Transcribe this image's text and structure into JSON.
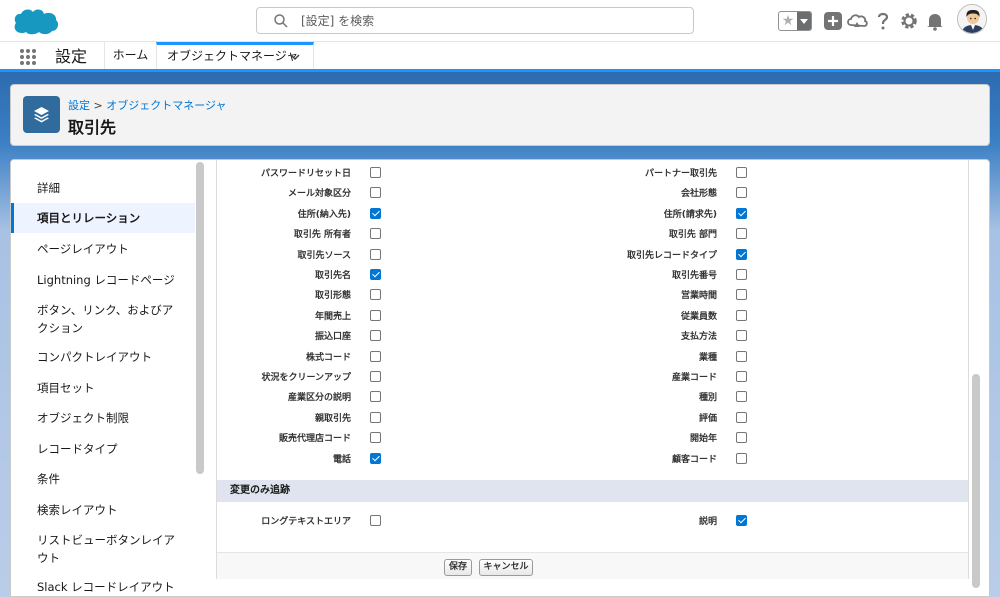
{
  "search": {
    "placeholder": "[設定] を検索"
  },
  "app_nav": {
    "app_name": "設定",
    "tabs": [
      {
        "label": "ホーム"
      },
      {
        "label": "オブジェクトマネージャ"
      }
    ]
  },
  "page_header": {
    "breadcrumb_root": "設定",
    "breadcrumb_separator": " > ",
    "breadcrumb_parent": "オブジェクトマネージャ",
    "title": "取引先"
  },
  "sidebar": {
    "items": [
      {
        "label": "詳細"
      },
      {
        "label": "項目とリレーション",
        "active": true
      },
      {
        "label": "ページレイアウト"
      },
      {
        "label": "Lightning レコードページ"
      },
      {
        "label": "ボタン、リンク、およびアクション"
      },
      {
        "label": "コンパクトレイアウト"
      },
      {
        "label": "項目セット"
      },
      {
        "label": "オブジェクト制限"
      },
      {
        "label": "レコードタイプ"
      },
      {
        "label": "条件"
      },
      {
        "label": "検索レイアウト"
      },
      {
        "label": "リストビューボタンレイアウト"
      },
      {
        "label": "Slack レコードレイアウト"
      }
    ]
  },
  "fields": {
    "left": [
      {
        "label": "パスワードリセット日",
        "checked": false
      },
      {
        "label": "メール対象区分",
        "checked": false
      },
      {
        "label": "住所(納入先)",
        "checked": true
      },
      {
        "label": "取引先 所有者",
        "checked": false
      },
      {
        "label": "取引先ソース",
        "checked": false
      },
      {
        "label": "取引先名",
        "checked": true
      },
      {
        "label": "取引形態",
        "checked": false
      },
      {
        "label": "年間売上",
        "checked": false
      },
      {
        "label": "振込口座",
        "checked": false
      },
      {
        "label": "株式コード",
        "checked": false
      },
      {
        "label": "状況をクリーンアップ",
        "checked": false
      },
      {
        "label": "産業区分の説明",
        "checked": false
      },
      {
        "label": "親取引先",
        "checked": false
      },
      {
        "label": "販売代理店コード",
        "checked": false
      },
      {
        "label": "電話",
        "checked": true
      }
    ],
    "right": [
      {
        "label": "パートナー取引先",
        "checked": false
      },
      {
        "label": "会社形態",
        "checked": false
      },
      {
        "label": "住所(請求先)",
        "checked": true
      },
      {
        "label": "取引先 部門",
        "checked": false
      },
      {
        "label": "取引先レコードタイプ",
        "checked": true
      },
      {
        "label": "取引先番号",
        "checked": false
      },
      {
        "label": "営業時間",
        "checked": false
      },
      {
        "label": "従業員数",
        "checked": false
      },
      {
        "label": "支払方法",
        "checked": false
      },
      {
        "label": "業種",
        "checked": false
      },
      {
        "label": "産業コード",
        "checked": false
      },
      {
        "label": "種別",
        "checked": false
      },
      {
        "label": "評価",
        "checked": false
      },
      {
        "label": "開始年",
        "checked": false
      },
      {
        "label": "顧客コード",
        "checked": false
      }
    ]
  },
  "change_only_section": {
    "header": "変更のみ追跡",
    "left": {
      "label": "ロングテキストエリア",
      "checked": false
    },
    "right": {
      "label": "説明",
      "checked": true
    }
  },
  "buttons": {
    "save": "保存",
    "cancel": "キャンセル"
  },
  "colors": {
    "brand": "#0176d3",
    "nav_accent": "#1b96ff",
    "object_icon": "#2f6c9d"
  }
}
